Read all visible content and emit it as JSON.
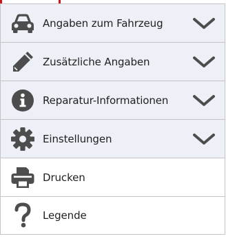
{
  "menu": {
    "items": [
      {
        "label": "Angaben zum Fahrzeug",
        "icon": "car-icon",
        "expandable": true
      },
      {
        "label": "Zusätzliche Angaben",
        "icon": "pencil-icon",
        "expandable": true
      },
      {
        "label": "Reparatur-Informationen",
        "icon": "info-icon",
        "expandable": true
      },
      {
        "label": "Einstellungen",
        "icon": "gear-icon",
        "expandable": true
      },
      {
        "label": "Drucken",
        "icon": "printer-icon",
        "expandable": false
      },
      {
        "label": "Legende",
        "icon": "question-mark-icon",
        "expandable": false
      }
    ]
  },
  "colors": {
    "icon": "#4d4d4d",
    "expandable_background": "#edf0f6",
    "plain_background": "#ffffff",
    "border": "#c4c4c4",
    "highlight": "#d0121b"
  }
}
